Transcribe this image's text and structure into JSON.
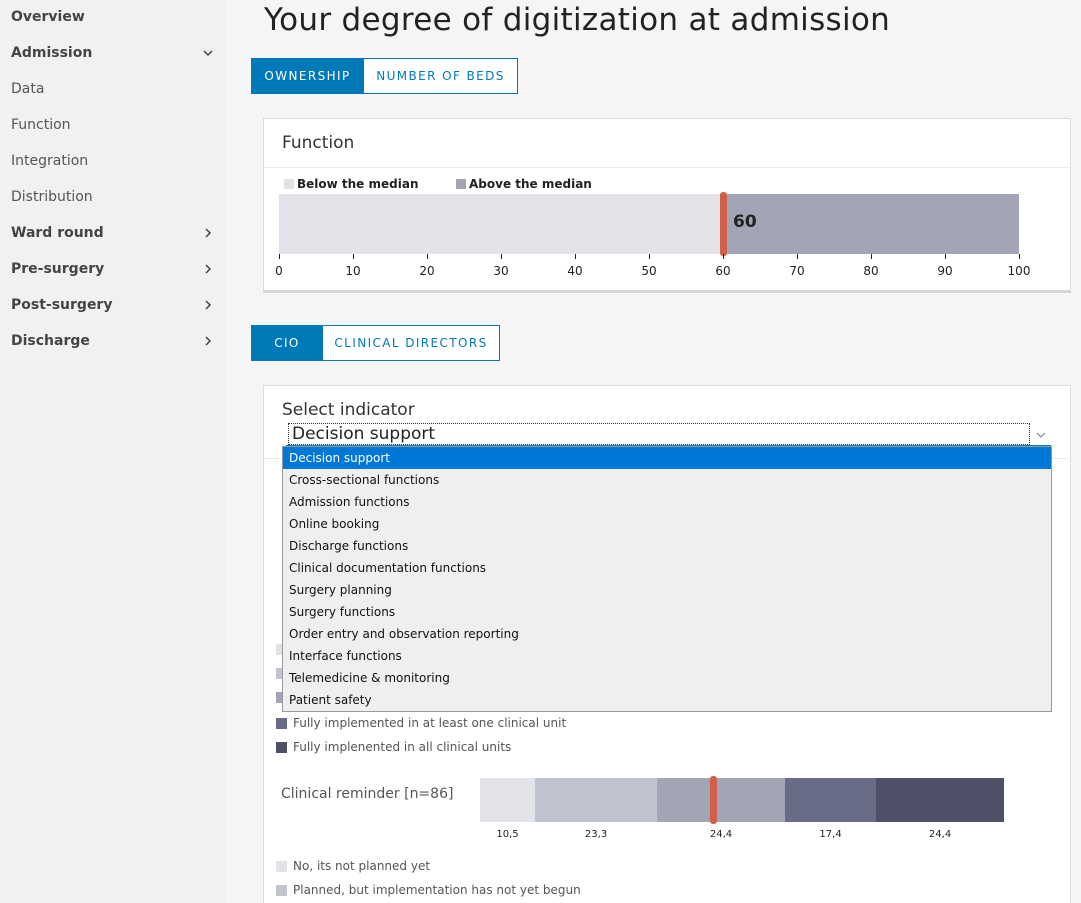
{
  "sidebar": {
    "items": [
      {
        "label": "Overview",
        "bold": true,
        "chevron": ""
      },
      {
        "label": "Admission",
        "bold": true,
        "chevron": "chevron-down"
      },
      {
        "label": "Data",
        "bold": false,
        "chevron": ""
      },
      {
        "label": "Function",
        "bold": false,
        "chevron": ""
      },
      {
        "label": "Integration",
        "bold": false,
        "chevron": ""
      },
      {
        "label": "Distribution",
        "bold": false,
        "chevron": ""
      },
      {
        "label": "Ward round",
        "bold": true,
        "chevron": "chevron-right"
      },
      {
        "label": "Pre-surgery",
        "bold": true,
        "chevron": "chevron-right"
      },
      {
        "label": "Post-surgery",
        "bold": true,
        "chevron": "chevron-right"
      },
      {
        "label": "Discharge",
        "bold": true,
        "chevron": "chevron-right"
      }
    ]
  },
  "page": {
    "title": "Your degree of digitization at admission"
  },
  "toggle1": {
    "options": [
      "OWNERSHIP",
      "NUMBER OF BEDS"
    ],
    "active": 0
  },
  "function_card": {
    "title": "Function",
    "legend": {
      "below": "Below the median",
      "above": "Above the median"
    },
    "colors": {
      "below": "#e2e3e8",
      "above": "#a2a5b6",
      "marker": "#d35f4b"
    }
  },
  "toggle2": {
    "options": [
      "CIO",
      "CLINICAL DIRECTORS"
    ],
    "active": 0
  },
  "indicator_card": {
    "label": "Select indicator",
    "selected": "Decision support",
    "options": [
      "Decision support",
      "Cross-sectional functions",
      "Admission functions",
      "Online booking",
      "Discharge functions",
      "Clinical documentation functions",
      "Surgery planning",
      "Surgery functions",
      "Order entry and observation reporting",
      "Interface functions",
      "Telemedicine & monitoring",
      "Patient safety"
    ],
    "legend_top": [
      {
        "label": "Fully implemented in at least one clinical unit",
        "color": "#686c87"
      },
      {
        "label": "Fully implenented in all clinical units",
        "color": "#4d5066"
      }
    ],
    "legend_bottom": [
      {
        "label": "No, its not planned yet",
        "color": "#e2e3e8"
      },
      {
        "label": "Planned, but implementation has not yet begun",
        "color": "#c1c3ce"
      }
    ]
  },
  "chart_data": [
    {
      "type": "bar",
      "orientation": "horizontal",
      "series": [
        {
          "name": "Below the median",
          "values": [
            60
          ]
        },
        {
          "name": "Above the median",
          "values": [
            40
          ]
        }
      ],
      "median_marker": 60,
      "marker_label": "60",
      "xlim": [
        0,
        100
      ],
      "xticks": [
        "0",
        "10",
        "20",
        "30",
        "40",
        "50",
        "60",
        "70",
        "80",
        "90",
        "100"
      ],
      "legend_position": "top-left",
      "grid": false
    },
    {
      "type": "bar",
      "orientation": "horizontal",
      "stacked": true,
      "categories": [
        "Clinical reminder [n=86]"
      ],
      "segments": [
        {
          "value": 10.5,
          "label": "10,5",
          "color": "#e2e3e8"
        },
        {
          "value": 23.3,
          "label": "23,3",
          "color": "#c1c3ce"
        },
        {
          "value": 24.4,
          "label": "24,4",
          "color": "#a2a5b6"
        },
        {
          "value": 17.4,
          "label": "17,4",
          "color": "#686c87"
        },
        {
          "value": 24.4,
          "label": "24,4",
          "color": "#4d5066"
        }
      ],
      "marker_value": 44.6,
      "marker_color": "#d35f4b",
      "xlim": [
        0,
        100
      ]
    }
  ]
}
